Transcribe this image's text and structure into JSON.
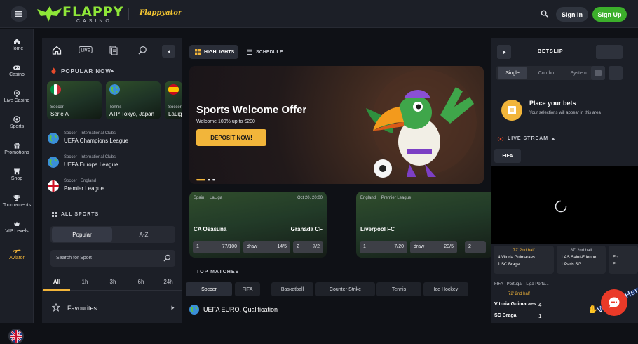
{
  "app": {
    "brand": "FLAPPY",
    "brand_sub": "CASINO",
    "game": "Flappyator",
    "signin": "Sign In",
    "signup": "Sign Up"
  },
  "nav": [
    {
      "label": "Home",
      "icon": "home-icon"
    },
    {
      "label": "Casino",
      "icon": "gamepad-icon"
    },
    {
      "label": "Live Casino",
      "icon": "live-casino-icon"
    },
    {
      "label": "Sports",
      "icon": "soccer-ball-icon"
    },
    {
      "label": "Promotions",
      "icon": "gift-icon"
    },
    {
      "label": "Shop",
      "icon": "shop-icon"
    },
    {
      "label": "Tournaments",
      "icon": "trophy-icon"
    },
    {
      "label": "VIP Levels",
      "icon": "vip-icon"
    },
    {
      "label": "Aviator",
      "icon": "airplane-icon"
    }
  ],
  "left": {
    "popular_title": "POPULAR NOW",
    "tiles": [
      {
        "cat": "Soccer",
        "name": "Serie A",
        "flag": "italy-flag-icon"
      },
      {
        "cat": "Tennis",
        "name": "ATP Tokyo, Japan",
        "flag": "globe-icon"
      },
      {
        "cat": "Soccer",
        "name": "LaLiga",
        "flag": "spain-flag-icon"
      }
    ],
    "leagues": [
      {
        "sub": "Soccer · International Clubs",
        "name": "UEFA Champions League",
        "flag": "globe-icon"
      },
      {
        "sub": "Soccer · International Clubs",
        "name": "UEFA Europa League",
        "flag": "globe-icon"
      },
      {
        "sub": "Soccer · England",
        "name": "Premier League",
        "flag": "england-flag-icon"
      }
    ],
    "all_sports": "ALL SPORTS",
    "seg_on": "Popular",
    "seg_off": "A-Z",
    "search_placeholder": "Search for Sport",
    "time_tabs": [
      "All",
      "1h",
      "3h",
      "6h",
      "24h"
    ],
    "favourites": "Favourites"
  },
  "center": {
    "tab_highlights": "HIGHLIGHTS",
    "tab_schedule": "SCHEDULE",
    "hero": {
      "title": "Sports Welcome Offer",
      "subtitle": "Welcome 100% up to €200",
      "cta": "DEPOSIT NOW!"
    },
    "matches": [
      {
        "country": "Spain",
        "league": "LaLiga",
        "date": "Oct 20, 20:00",
        "home": "CA Osasuna",
        "away": "Granada CF",
        "odds": [
          {
            "l": "1",
            "r": "77/100"
          },
          {
            "l": "draw",
            "r": "14/5"
          },
          {
            "l": "2",
            "r": "7/2"
          }
        ]
      },
      {
        "country": "England",
        "league": "Premier League",
        "date": "",
        "home": "Liverpool FC",
        "away": "",
        "odds": [
          {
            "l": "1",
            "r": "7/20"
          },
          {
            "l": "draw",
            "r": "23/5"
          },
          {
            "l": "2",
            "r": ""
          }
        ]
      }
    ],
    "top_matches": "TOP MATCHES",
    "sport_tabs": [
      "Soccer",
      "FIFA",
      "Basketball",
      "Counter-Strike",
      "Tennis",
      "Ice Hockey"
    ],
    "first_league": "UEFA EURO, Qualification"
  },
  "right": {
    "betslip": "BETSLIP",
    "bet_types": [
      "Single",
      "Combo",
      "System"
    ],
    "place_title": "Place your bets",
    "place_sub": "Your selections will appear in this area",
    "live_stream": "LIVE STREAM",
    "fifa": "FIFA",
    "live_cards": [
      {
        "time": "72' 2nd half",
        "t1": "4 Vitoria Guimaraes",
        "t2": "1 SC Braga"
      },
      {
        "time": "87' 2nd half",
        "t1": "1 AS Saint-Etienne",
        "t2": "1 Paris SG"
      },
      {
        "time": "",
        "t1": "Ec",
        "t2": "Fr"
      }
    ],
    "score_header": "FIFA · Portugal · Liga Portu...",
    "score_time": "72' 2nd half",
    "score_t1": "Vitoria Guimaraes",
    "score_t2": "SC Braga",
    "score_s1": "4",
    "score_s2": "1"
  },
  "chat": {
    "badge": "We Are Here!"
  },
  "colors": {
    "accent": "#f2b53a",
    "brand_green": "#8ee638",
    "signup": "#3caf2b",
    "chat": "#ea3a28"
  }
}
